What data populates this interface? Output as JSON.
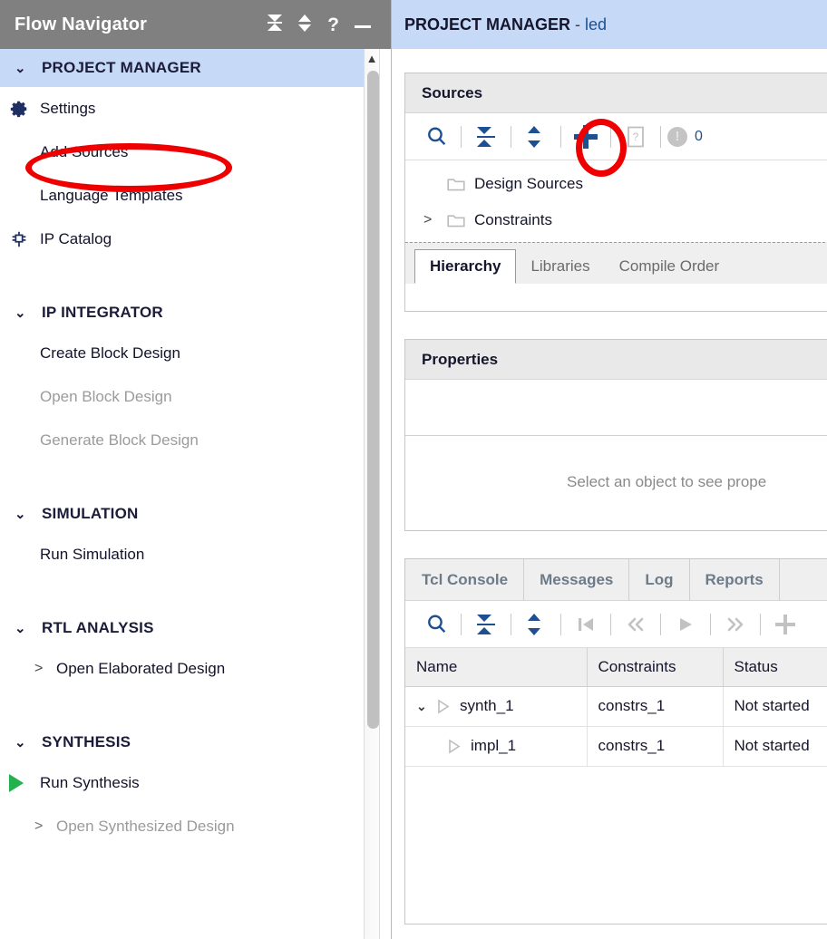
{
  "flow_navigator": {
    "title": "Flow Navigator",
    "header_icons": [
      {
        "name": "collapse-all-icon",
        "glyph": "collapse"
      },
      {
        "name": "expand-collapse-icon",
        "glyph": "updown"
      },
      {
        "name": "help-icon",
        "glyph": "?"
      },
      {
        "name": "minimize-icon",
        "glyph": "minimize"
      }
    ],
    "groups": [
      {
        "label": "PROJECT MANAGER",
        "highlighted": true,
        "items": [
          {
            "label": "Settings",
            "icon": "gear-icon",
            "disabled": false
          },
          {
            "label": "Add Sources",
            "icon": "",
            "disabled": false,
            "annotated": true
          },
          {
            "label": "Language Templates",
            "icon": "",
            "disabled": false
          },
          {
            "label": "IP Catalog",
            "icon": "ip-chip-icon",
            "disabled": false
          }
        ]
      },
      {
        "label": "IP INTEGRATOR",
        "highlighted": false,
        "items": [
          {
            "label": "Create Block Design",
            "icon": "",
            "disabled": false
          },
          {
            "label": "Open Block Design",
            "icon": "",
            "disabled": true
          },
          {
            "label": "Generate Block Design",
            "icon": "",
            "disabled": true
          }
        ]
      },
      {
        "label": "SIMULATION",
        "highlighted": false,
        "items": [
          {
            "label": "Run Simulation",
            "icon": "",
            "disabled": false
          }
        ]
      },
      {
        "label": "RTL ANALYSIS",
        "highlighted": false,
        "items": [
          {
            "label": "Open Elaborated Design",
            "icon": "",
            "disabled": false,
            "expander": ">"
          }
        ]
      },
      {
        "label": "SYNTHESIS",
        "highlighted": false,
        "items": [
          {
            "label": "Run Synthesis",
            "icon": "play-icon",
            "disabled": false
          },
          {
            "label": "Open Synthesized Design",
            "icon": "",
            "disabled": true,
            "expander": ">"
          }
        ]
      }
    ]
  },
  "project_manager": {
    "title": "PROJECT MANAGER",
    "separator": "-",
    "project_name": "led"
  },
  "sources_panel": {
    "title": "Sources",
    "toolbar": {
      "search": "search-icon",
      "collapse_all": "collapse-all-icon",
      "expand_all": "expand-all-icon",
      "add_sources": "plus-icon",
      "help": "help-doc-icon",
      "warning_count": "0"
    },
    "tree": [
      {
        "label": "Design Sources",
        "expander": "",
        "icon": "folder-icon"
      },
      {
        "label": "Constraints",
        "expander": ">",
        "icon": "folder-icon"
      }
    ],
    "tabs": [
      {
        "label": "Hierarchy",
        "active": true
      },
      {
        "label": "Libraries",
        "active": false
      },
      {
        "label": "Compile Order",
        "active": false
      }
    ]
  },
  "properties_panel": {
    "title": "Properties",
    "empty_message": "Select an object to see prope"
  },
  "console_panel": {
    "tabs": [
      {
        "label": "Tcl Console"
      },
      {
        "label": "Messages"
      },
      {
        "label": "Log"
      },
      {
        "label": "Reports"
      }
    ],
    "toolbar": [
      {
        "name": "search-icon"
      },
      {
        "name": "collapse-all-icon"
      },
      {
        "name": "expand-all-icon"
      },
      {
        "name": "skip-to-start-icon"
      },
      {
        "name": "rewind-icon"
      },
      {
        "name": "play-icon"
      },
      {
        "name": "fast-forward-icon"
      },
      {
        "name": "plus-icon"
      }
    ],
    "table": {
      "columns": [
        "Name",
        "Constraints",
        "Status"
      ],
      "rows": [
        {
          "chevron": "v",
          "indent": 0,
          "name": "synth_1",
          "constraints": "constrs_1",
          "status": "Not started"
        },
        {
          "chevron": "",
          "indent": 1,
          "name": "impl_1",
          "constraints": "constrs_1",
          "status": "Not started"
        }
      ]
    }
  },
  "annotations": {
    "color": "#ee0000",
    "shapes": [
      {
        "name": "add-sources-highlight",
        "target": "Add Sources"
      },
      {
        "name": "plus-button-highlight",
        "target": "plus-icon"
      }
    ]
  }
}
